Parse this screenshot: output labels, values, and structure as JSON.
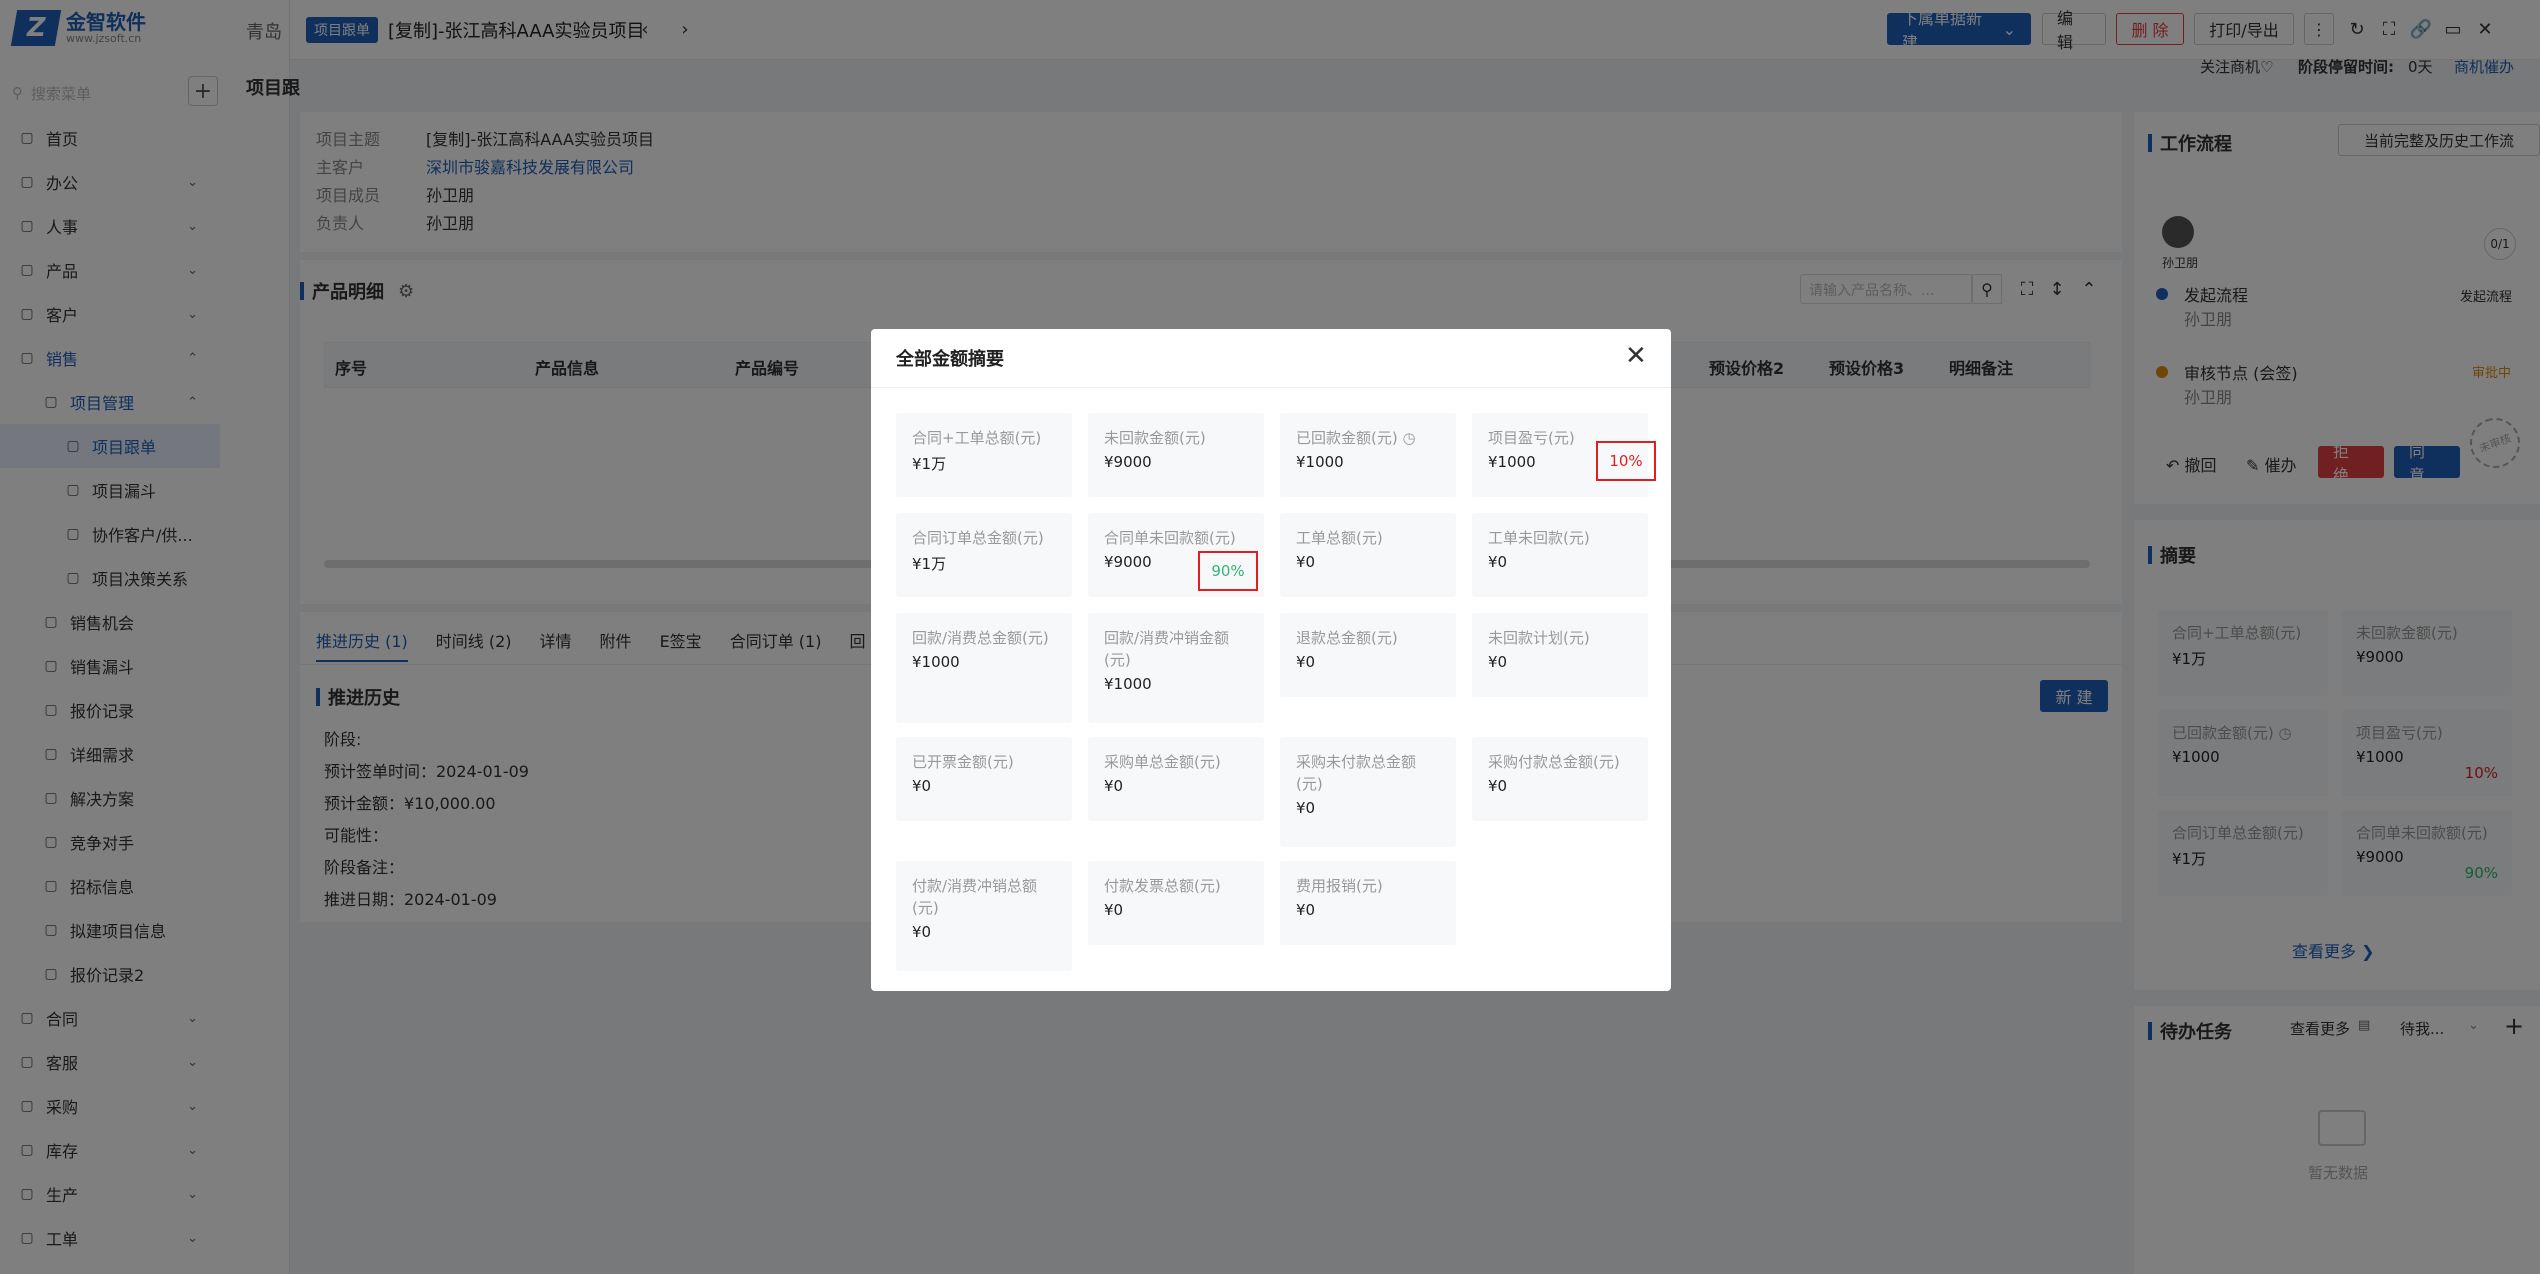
{
  "brand": {
    "logo_mark": "Z",
    "name": "金智软件",
    "sub": "www.jzsoft.cn"
  },
  "sidebar": {
    "search_placeholder": "搜索菜单",
    "items": [
      {
        "label": "首页",
        "icon": "home-icon",
        "level": 0
      },
      {
        "label": "办公",
        "icon": "office-icon",
        "level": 0,
        "chev": "⌄"
      },
      {
        "label": "人事",
        "icon": "people-icon",
        "level": 0,
        "chev": "⌄"
      },
      {
        "label": "产品",
        "icon": "product-icon",
        "level": 0,
        "chev": "⌄"
      },
      {
        "label": "客户",
        "icon": "customer-icon",
        "level": 0,
        "chev": "⌄"
      },
      {
        "label": "销售",
        "icon": "sales-icon",
        "level": 0,
        "chev": "⌃"
      },
      {
        "label": "项目管理",
        "icon": "project-icon",
        "level": 1,
        "chev": "⌃"
      },
      {
        "label": "项目跟单",
        "icon": "doc-icon",
        "level": 2
      },
      {
        "label": "项目漏斗",
        "icon": "funnel-icon",
        "level": 2
      },
      {
        "label": "协作客户/供...",
        "icon": "doc-icon",
        "level": 2
      },
      {
        "label": "项目决策关系",
        "icon": "doc-icon",
        "level": 2
      },
      {
        "label": "销售机会",
        "icon": "opportunity-icon",
        "level": 1
      },
      {
        "label": "销售漏斗",
        "icon": "funnel-icon",
        "level": 1
      },
      {
        "label": "报价记录",
        "icon": "doc-icon",
        "level": 1
      },
      {
        "label": "详细需求",
        "icon": "doc-icon",
        "level": 1
      },
      {
        "label": "解决方案",
        "icon": "bulb-icon",
        "level": 1
      },
      {
        "label": "竞争对手",
        "icon": "doc-icon",
        "level": 1
      },
      {
        "label": "招标信息",
        "icon": "doc-icon",
        "level": 1
      },
      {
        "label": "拟建项目信息",
        "icon": "doc-icon",
        "level": 1
      },
      {
        "label": "报价记录2",
        "icon": "doc-icon",
        "level": 1
      },
      {
        "label": "合同",
        "icon": "contract-icon",
        "level": 0,
        "chev": "⌄"
      },
      {
        "label": "客服",
        "icon": "service-icon",
        "level": 0,
        "chev": "⌄"
      },
      {
        "label": "采购",
        "icon": "purchase-icon",
        "level": 0,
        "chev": "⌄"
      },
      {
        "label": "库存",
        "icon": "stock-icon",
        "level": 0,
        "chev": "⌄"
      },
      {
        "label": "生产",
        "icon": "production-icon",
        "level": 0,
        "chev": "⌄"
      },
      {
        "label": "工单",
        "icon": "ticket-icon",
        "level": 0,
        "chev": "⌄"
      }
    ]
  },
  "tabs_bar": {
    "tab1": "青岛",
    "page_title": "项目跟"
  },
  "header": {
    "tag": "项目跟单",
    "title": "[复制]-张江高科AAA实验员项目",
    "buttons": {
      "new_sub": "下属单据新建",
      "edit": "编 辑",
      "delete": "删 除",
      "print": "打印/导出"
    },
    "follow": "关注商机♡",
    "stall_label": "阶段停留时间:",
    "stall_value": "0天",
    "remind": "商机催办"
  },
  "info": {
    "rows": [
      {
        "k": "项目主题",
        "v": "[复制]-张江高科AAA实验员项目"
      },
      {
        "k": "主客户",
        "v": "深圳市骏嘉科技发展有限公司"
      },
      {
        "k": "项目成员",
        "v": "孙卫朋"
      },
      {
        "k": "负责人",
        "v": "孙卫朋"
      }
    ]
  },
  "products": {
    "title": "产品明细",
    "search_placeholder": "请输入产品名称、...",
    "columns": [
      "序号",
      "产品信息",
      "产品编号",
      "预设价格2",
      "预设价格3",
      "明细备注"
    ]
  },
  "bottom_tabs": [
    "推进历史 (1)",
    "时间线 (2)",
    "详情",
    "附件",
    "E签宝",
    "合同订单 (1)",
    "回"
  ],
  "history": {
    "title": "推进历史",
    "new_btn": "新 建",
    "lines": [
      "阶段:",
      "预计签单时间：2024-01-09",
      "预计金额：¥10,000.00",
      "可能性：",
      "阶段备注：",
      "推进日期：2024-01-09"
    ]
  },
  "workflow": {
    "title": "工作流程",
    "btn": "当前完整及历史工作流",
    "user": "孙卫朋",
    "counter": "0/1",
    "steps": [
      {
        "name": "发起流程",
        "person": "孙卫朋",
        "status": "发起流程"
      },
      {
        "name": "审核节点 (会签)",
        "person": "孙卫朋",
        "status": "审批中"
      }
    ],
    "actions": {
      "revoke": "撤回",
      "urge": "催办",
      "reject": "拒 绝",
      "approve": "同 意"
    },
    "stamp": "未审核"
  },
  "summary": {
    "title": "摘要",
    "cards": [
      {
        "label": "合同+工单总额(元)",
        "value": "¥1万"
      },
      {
        "label": "未回款金额(元)",
        "value": "¥9000"
      },
      {
        "label": "已回款金额(元) ◷",
        "value": "¥1000"
      },
      {
        "label": "项目盈亏(元)",
        "value": "¥1000",
        "pct": "10%"
      },
      {
        "label": "合同订单总金额(元)",
        "value": "¥1万"
      },
      {
        "label": "合同单未回款额(元)",
        "value": "¥9000",
        "pct": "90%"
      }
    ],
    "more": "查看更多 ❯"
  },
  "todo": {
    "title": "待办任务",
    "more": "查看更多",
    "filter": "待我...",
    "empty": "暂无数据"
  },
  "modal": {
    "title": "全部金额摘要",
    "cards": [
      {
        "label": "合同+工单总额(元)",
        "value": "¥1万"
      },
      {
        "label": "未回款金额(元)",
        "value": "¥9000"
      },
      {
        "label": "已回款金额(元) ◷",
        "value": "¥1000"
      },
      {
        "label": "项目盈亏(元)",
        "value": "¥1000",
        "pct": "10%"
      },
      {
        "label": "合同订单总金额(元)",
        "value": "¥1万"
      },
      {
        "label": "合同单未回款额(元)",
        "value": "¥9000",
        "pct": "90%"
      },
      {
        "label": "工单总额(元)",
        "value": "¥0"
      },
      {
        "label": "工单未回款(元)",
        "value": "¥0"
      },
      {
        "label": "回款/消费总金额(元)",
        "value": "¥1000"
      },
      {
        "label": "回款/消费冲销金额(元)",
        "value": "¥1000"
      },
      {
        "label": "退款总金额(元)",
        "value": "¥0"
      },
      {
        "label": "未回款计划(元)",
        "value": "¥0"
      },
      {
        "label": "已开票金额(元)",
        "value": "¥0"
      },
      {
        "label": "采购单总金额(元)",
        "value": "¥0"
      },
      {
        "label": "采购未付款总金额(元)",
        "value": "¥0"
      },
      {
        "label": "采购付款总金额(元)",
        "value": "¥0"
      },
      {
        "label": "付款/消费冲销总额(元)",
        "value": "¥0"
      },
      {
        "label": "付款发票总额(元)",
        "value": "¥0"
      },
      {
        "label": "费用报销(元)",
        "value": "¥0"
      }
    ]
  },
  "colors": {
    "accent": "#1e5fb8",
    "danger": "#e02020",
    "success": "#2eb872"
  }
}
